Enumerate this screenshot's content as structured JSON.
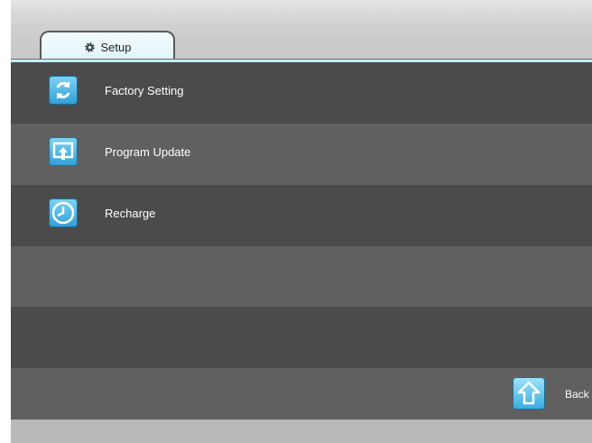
{
  "tabs": [
    {
      "label": "Setup",
      "icon": "gear-icon",
      "active": true
    }
  ],
  "menu": {
    "items": [
      {
        "label": "Factory Setting",
        "icon": "refresh-icon"
      },
      {
        "label": "Program Update",
        "icon": "upload-icon"
      },
      {
        "label": "Recharge",
        "icon": "clock-icon"
      }
    ]
  },
  "footer": {
    "back_label": "Back",
    "back_icon": "back-arrow-icon"
  },
  "colors": {
    "tab_background": "#dff5f9",
    "row_dark": "#4b4b4b",
    "row_light": "#606060",
    "icon_blue": "#2f9ed6"
  }
}
